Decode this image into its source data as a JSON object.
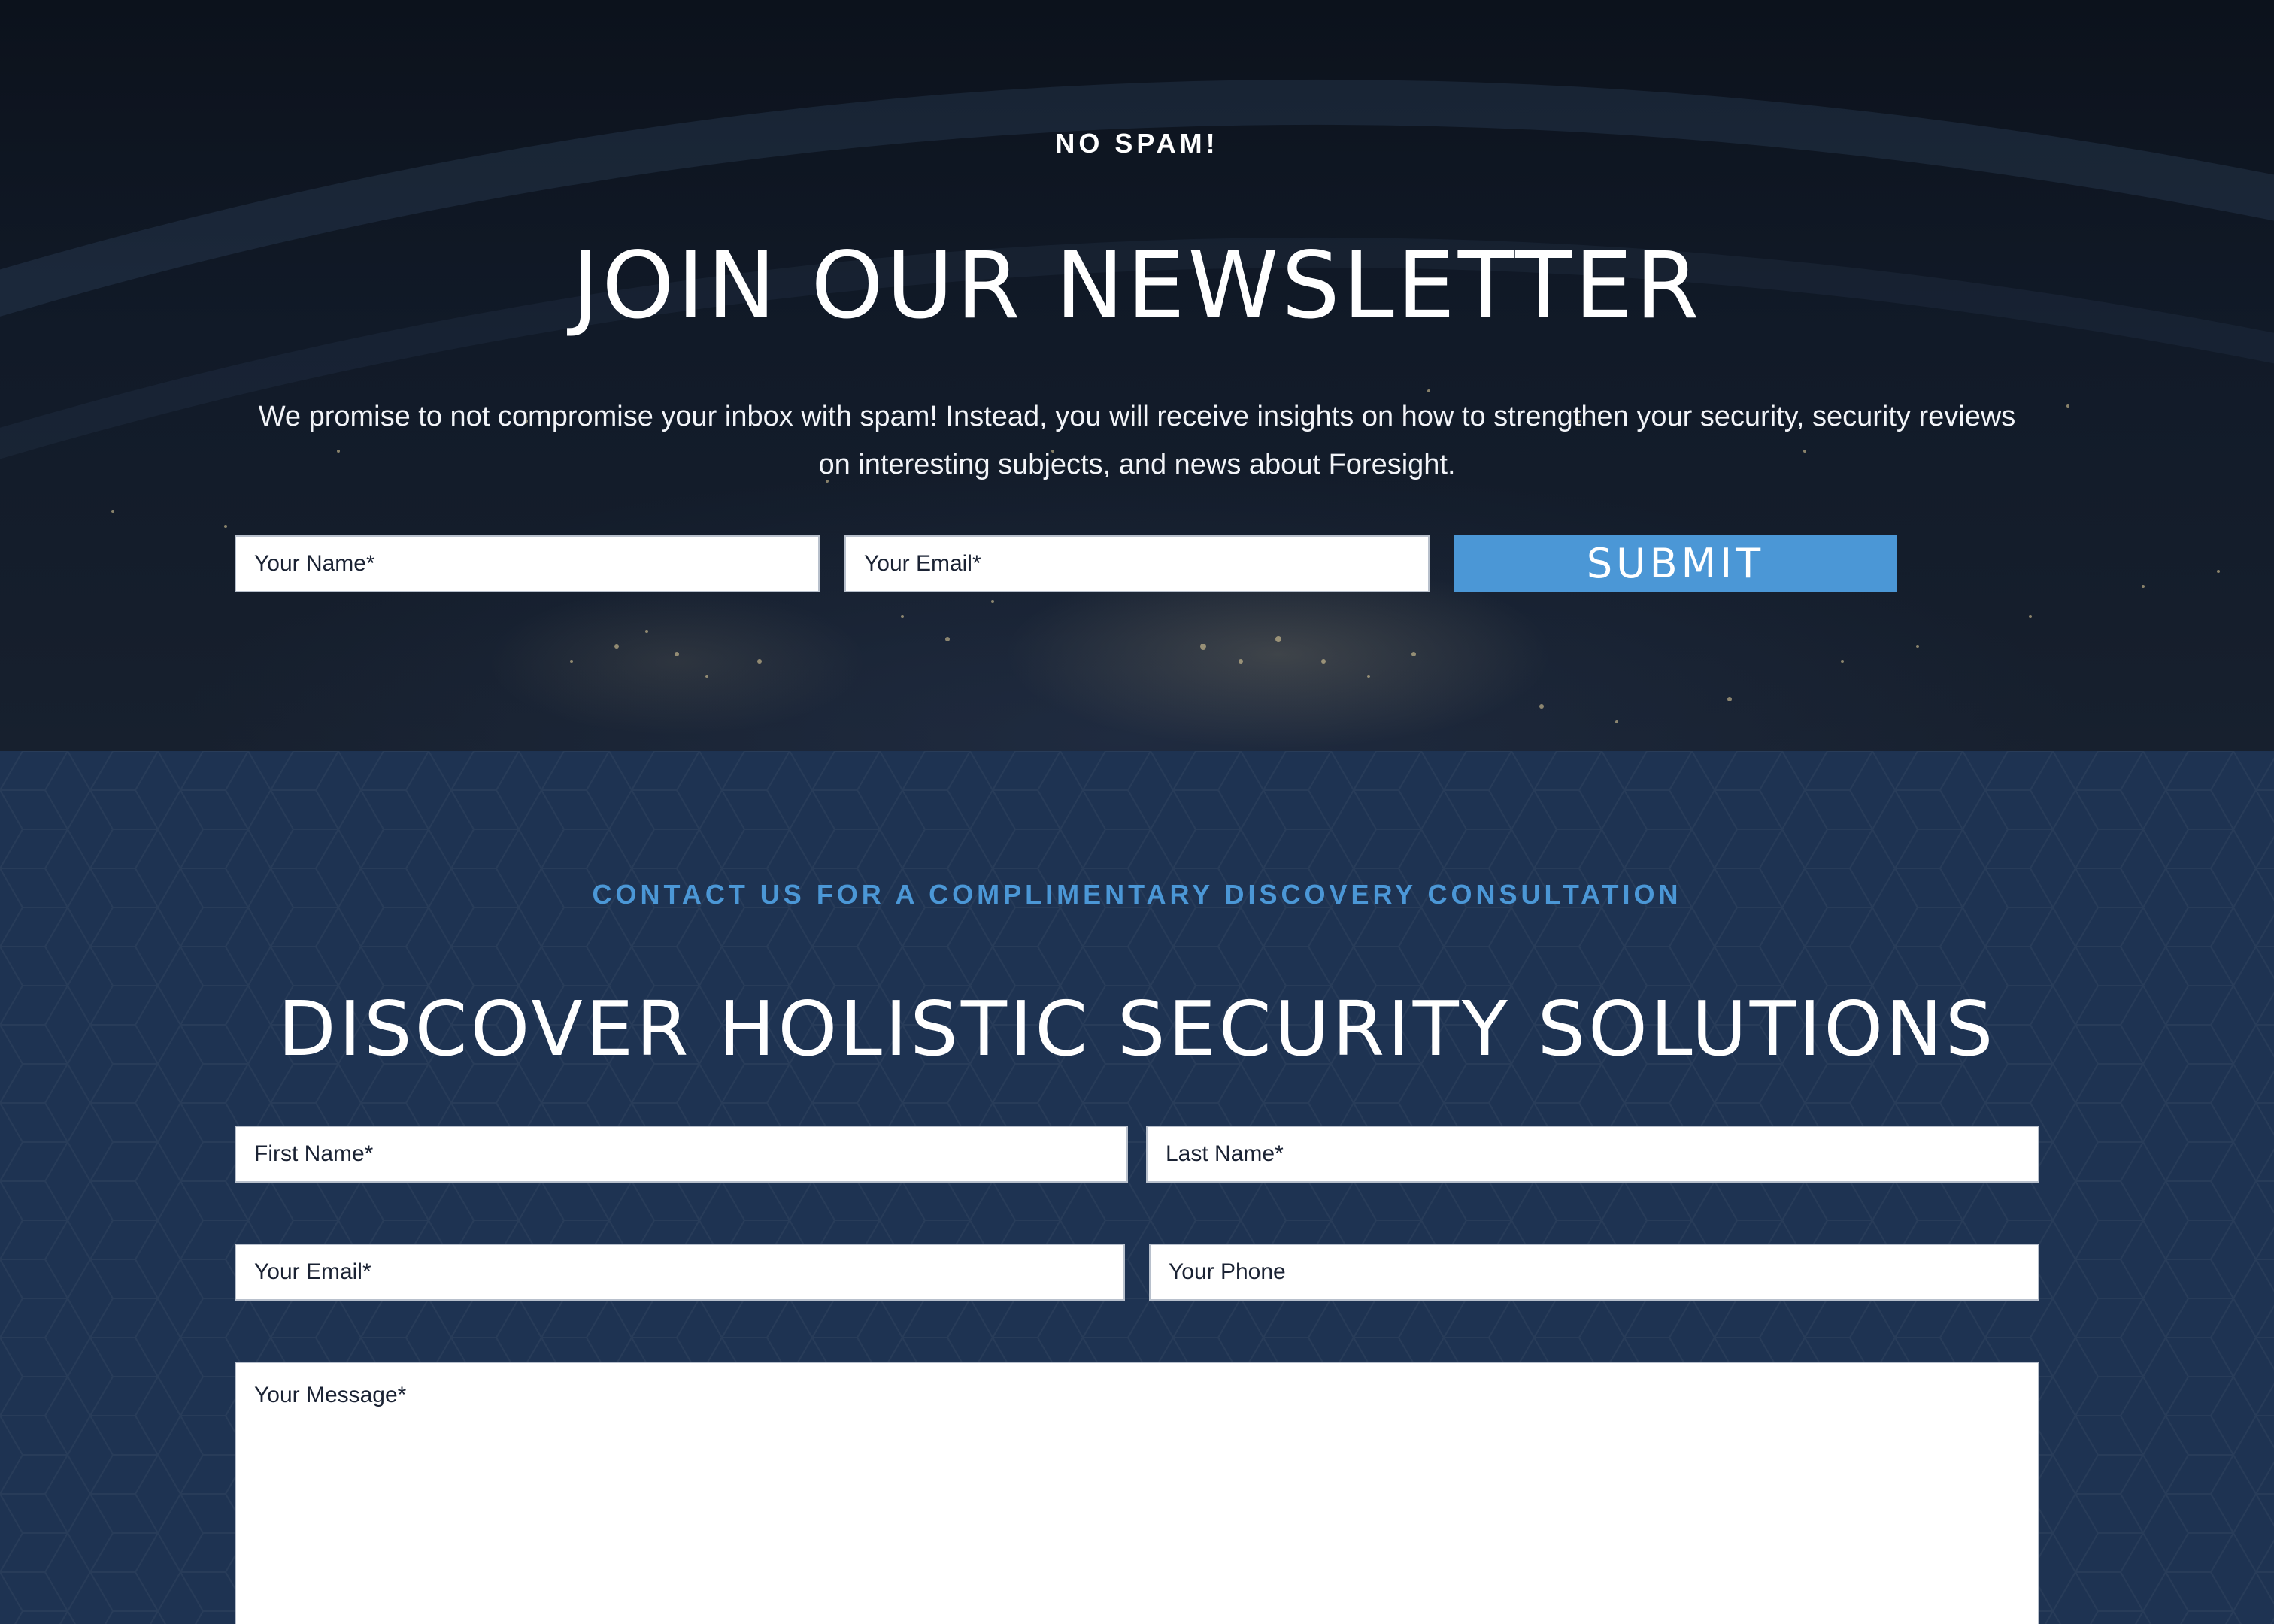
{
  "newsletter": {
    "eyebrow": "NO SPAM!",
    "title": "JOIN OUR NEWSLETTER",
    "description": "We promise to not compromise your inbox with spam! Instead, you will receive insights on how to strengthen your security, security reviews on interesting subjects, and news about Foresight.",
    "name_placeholder": "Your Name*",
    "email_placeholder": "Your Email*",
    "submit_label": "SUBMIT"
  },
  "contact": {
    "eyebrow": "CONTACT US FOR A COMPLIMENTARY DISCOVERY CONSULTATION",
    "title": "DISCOVER HOLISTIC SECURITY SOLUTIONS",
    "first_name_placeholder": "First Name*",
    "last_name_placeholder": "Last Name*",
    "email_placeholder": "Your Email*",
    "phone_placeholder": "Your Phone",
    "message_placeholder": "Your Message*"
  },
  "colors": {
    "accent": "#4b97d6",
    "contact_background": "#1e3352",
    "newsletter_background": "#0f1723"
  }
}
